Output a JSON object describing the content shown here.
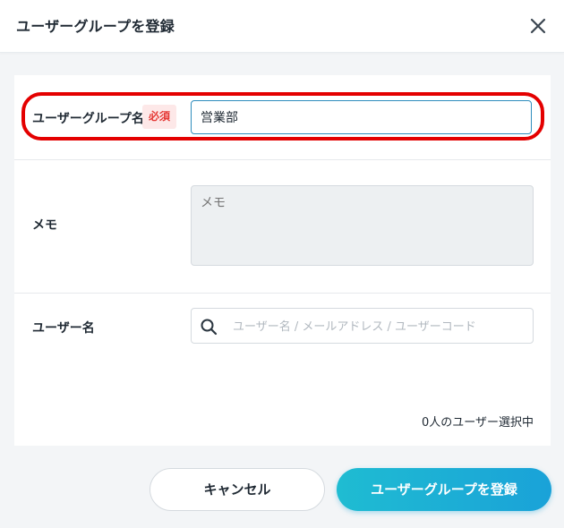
{
  "dialog": {
    "title": "ユーザーグループを登録",
    "close_icon": "close-icon"
  },
  "form": {
    "group_name": {
      "label": "ユーザーグループ名",
      "required_badge": "必須",
      "value": "営業部"
    },
    "memo": {
      "label": "メモ",
      "placeholder": "メモ"
    },
    "users": {
      "label": "ユーザー名",
      "search_icon": "search-icon",
      "placeholder": "ユーザー名 / メールアドレス / ユーザーコード",
      "selected_count_text": "0人のユーザー選択中"
    }
  },
  "footer": {
    "cancel_label": "キャンセル",
    "submit_label": "ユーザーグループを登録"
  },
  "colors": {
    "accent": "#1aa2d8",
    "required": "#e53935",
    "highlight": "#e40000"
  }
}
